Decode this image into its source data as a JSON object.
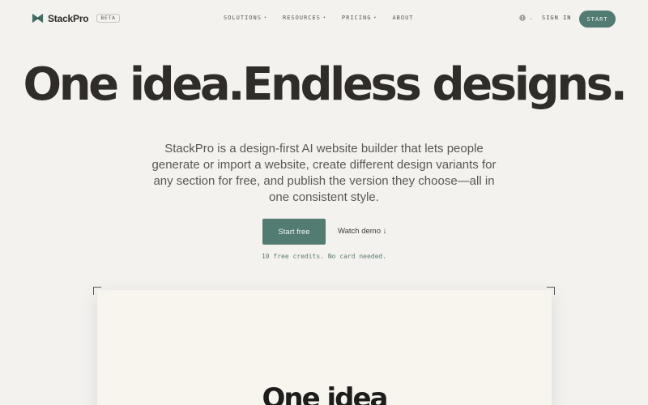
{
  "brand": {
    "name": "StackPro",
    "badge": "BETA"
  },
  "nav": {
    "items": [
      {
        "label": "SOLUTIONS",
        "caret": "▾"
      },
      {
        "label": "RESOURCES",
        "caret": "▾"
      },
      {
        "label": "PRICING",
        "caret": "▾"
      },
      {
        "label": "ABOUT",
        "caret": ""
      }
    ],
    "language_icon": "globe-icon",
    "language_chevron": "⌄",
    "signin_label": "SIGN IN",
    "start_label": "START"
  },
  "hero": {
    "title": "One idea.Endless designs.",
    "description": "StackPro is a design-first AI website builder that lets people generate or import a website, create different design variants for any section for free, and publish the version they choose—all in one consistent style.",
    "primary_cta": "Start free",
    "secondary_cta": "Watch demo ↓",
    "note": "10 free credits. No card needed."
  },
  "preview": {
    "title": "One idea"
  },
  "colors": {
    "background": "#f3f2ef",
    "accent": "#527b72",
    "text": "#2f2c29",
    "muted": "#5b5852",
    "preview_bg": "#f8f5ef"
  }
}
